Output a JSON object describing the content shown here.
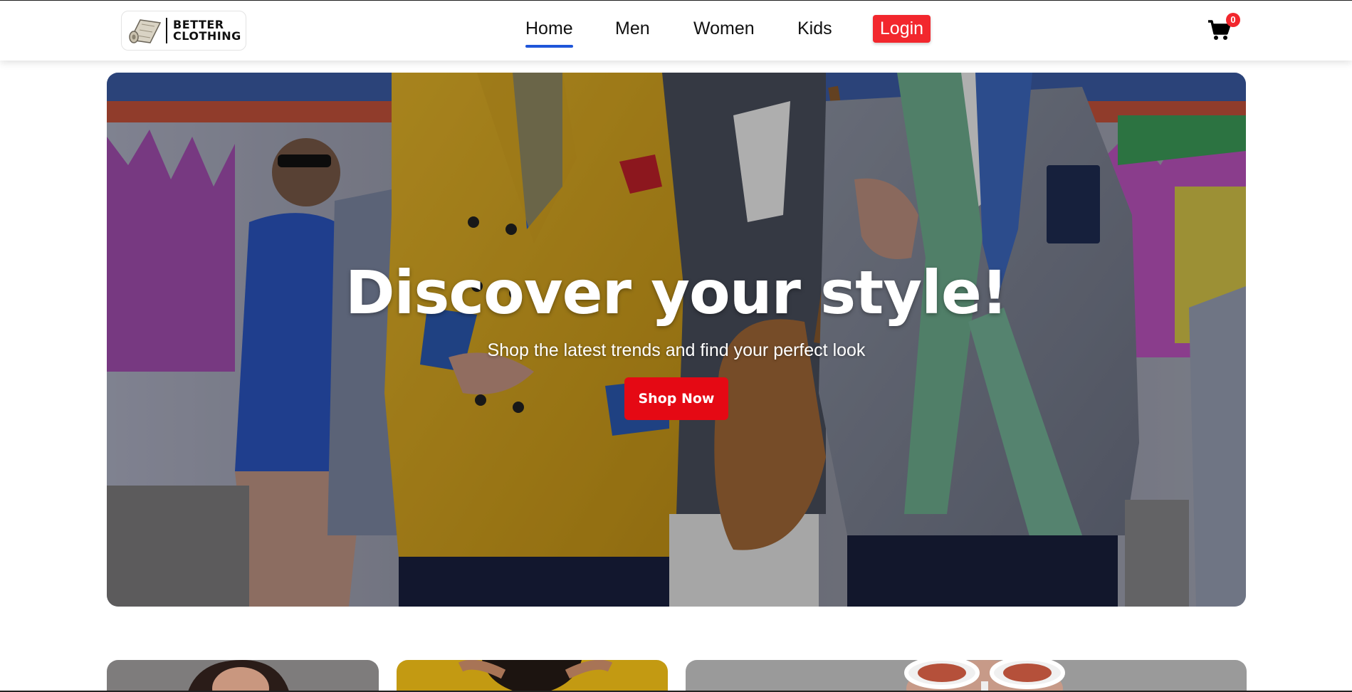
{
  "brand": {
    "name_line1": "BETTER",
    "name_line2": "CLOTHING",
    "icon": "fabric-roll-icon"
  },
  "nav": {
    "items": [
      {
        "label": "Home",
        "active": true
      },
      {
        "label": "Men",
        "active": false
      },
      {
        "label": "Women",
        "active": false
      },
      {
        "label": "Kids",
        "active": false
      }
    ],
    "login_label": "Login",
    "active_color": "#1f56d9"
  },
  "cart": {
    "icon": "shopping-cart-icon",
    "count": "0",
    "badge_color": "#f2272d"
  },
  "hero": {
    "title": "Discover your style!",
    "subtitle": "Shop the latest trends and find your perfect look",
    "cta_label": "Shop Now",
    "cta_color": "#e50914"
  },
  "categories": [
    {
      "image": "woman-portrait-photo"
    },
    {
      "image": "curly-hair-yellow-background-photo"
    },
    {
      "image": "sunglasses-person-photo"
    }
  ]
}
